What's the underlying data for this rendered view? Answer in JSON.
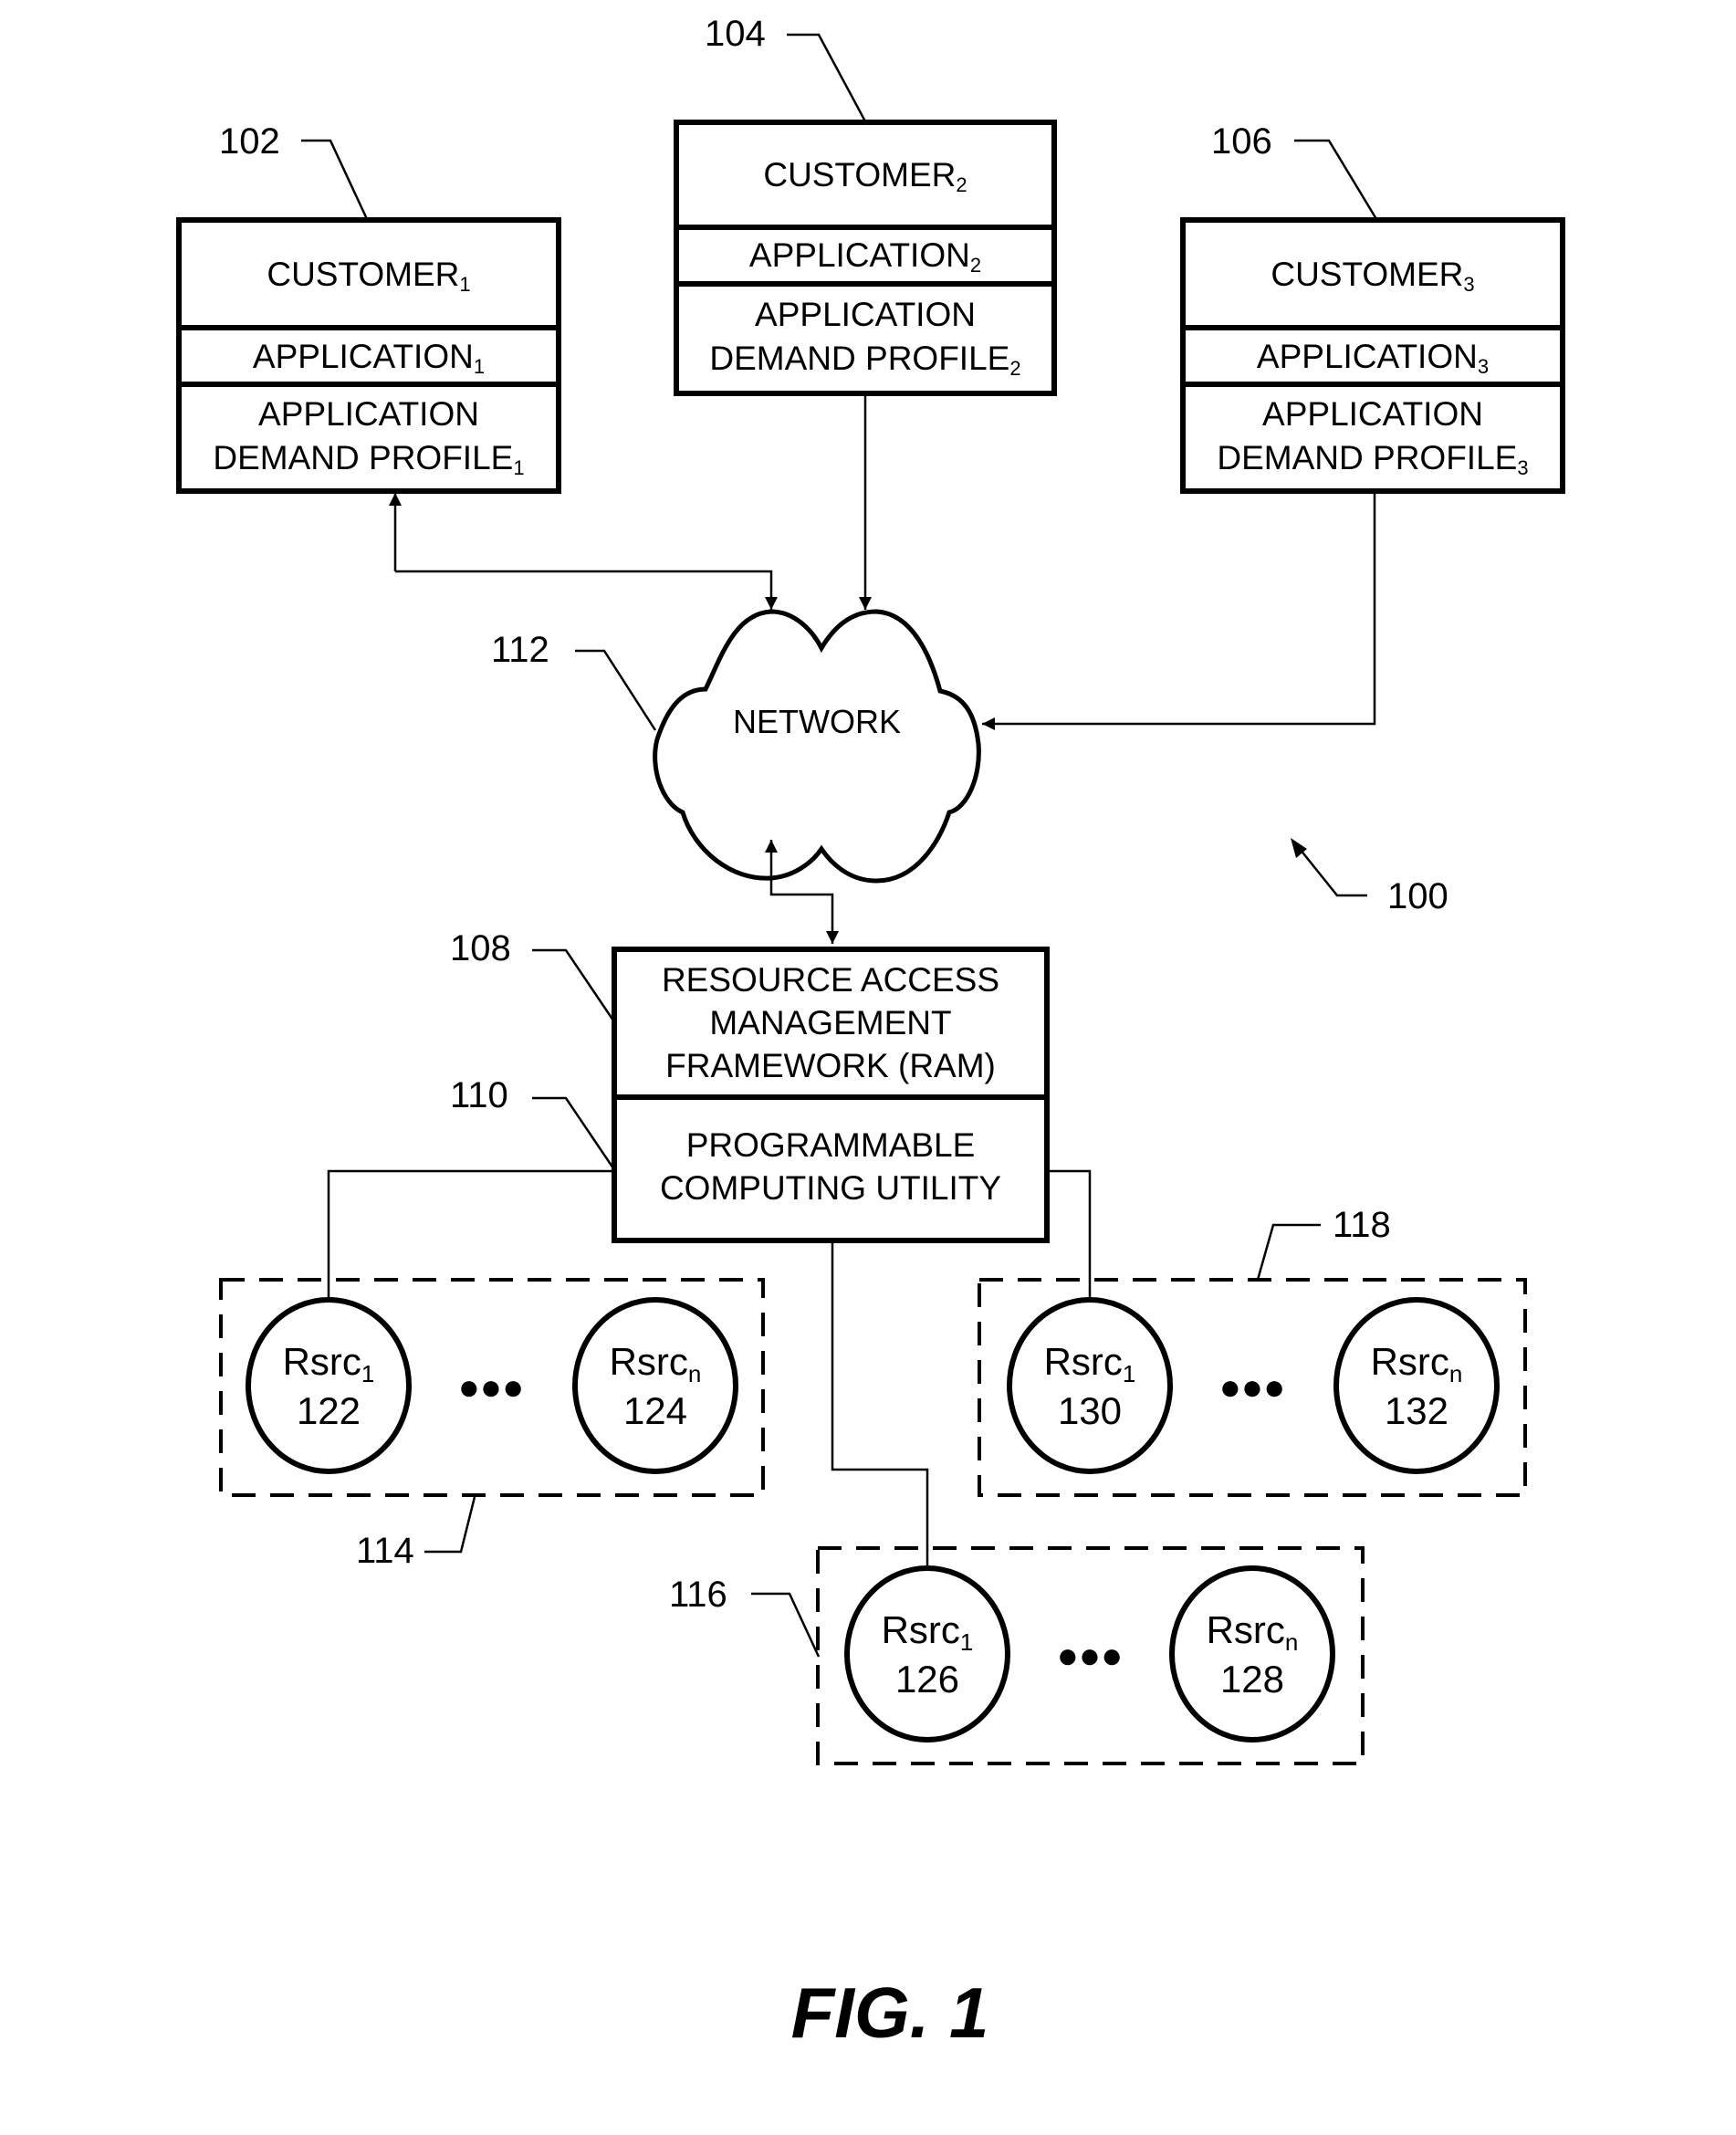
{
  "figure": {
    "caption": "FIG. 1",
    "system_ref": "100"
  },
  "customers": [
    {
      "ref": "102",
      "customer": "CUSTOMER",
      "customer_sub": "1",
      "application": "APPLICATION",
      "application_sub": "1",
      "profile_line1": "APPLICATION",
      "profile_line2": "DEMAND PROFILE",
      "profile_sub": "1"
    },
    {
      "ref": "104",
      "customer": "CUSTOMER",
      "customer_sub": "2",
      "application": "APPLICATION",
      "application_sub": "2",
      "profile_line1": "APPLICATION",
      "profile_line2": "DEMAND PROFILE",
      "profile_sub": "2"
    },
    {
      "ref": "106",
      "customer": "CUSTOMER",
      "customer_sub": "3",
      "application": "APPLICATION",
      "application_sub": "3",
      "profile_line1": "APPLICATION",
      "profile_line2": "DEMAND PROFILE",
      "profile_sub": "3"
    }
  ],
  "network": {
    "ref": "112",
    "label": "NETWORK"
  },
  "ram": {
    "ref": "108",
    "line1": "RESOURCE ACCESS",
    "line2": "MANAGEMENT",
    "line3": "FRAMEWORK (RAM)"
  },
  "utility": {
    "ref": "110",
    "line1": "PROGRAMMABLE",
    "line2": "COMPUTING UTILITY"
  },
  "resource_groups": [
    {
      "ref": "114",
      "first": {
        "name": "Rsrc",
        "sub": "1",
        "ref": "122"
      },
      "last": {
        "name": "Rsrc",
        "sub": "n",
        "ref": "124"
      }
    },
    {
      "ref": "116",
      "first": {
        "name": "Rsrc",
        "sub": "1",
        "ref": "126"
      },
      "last": {
        "name": "Rsrc",
        "sub": "n",
        "ref": "128"
      }
    },
    {
      "ref": "118",
      "first": {
        "name": "Rsrc",
        "sub": "1",
        "ref": "130"
      },
      "last": {
        "name": "Rsrc",
        "sub": "n",
        "ref": "132"
      }
    }
  ],
  "ellipsis_glyph": "●●●"
}
